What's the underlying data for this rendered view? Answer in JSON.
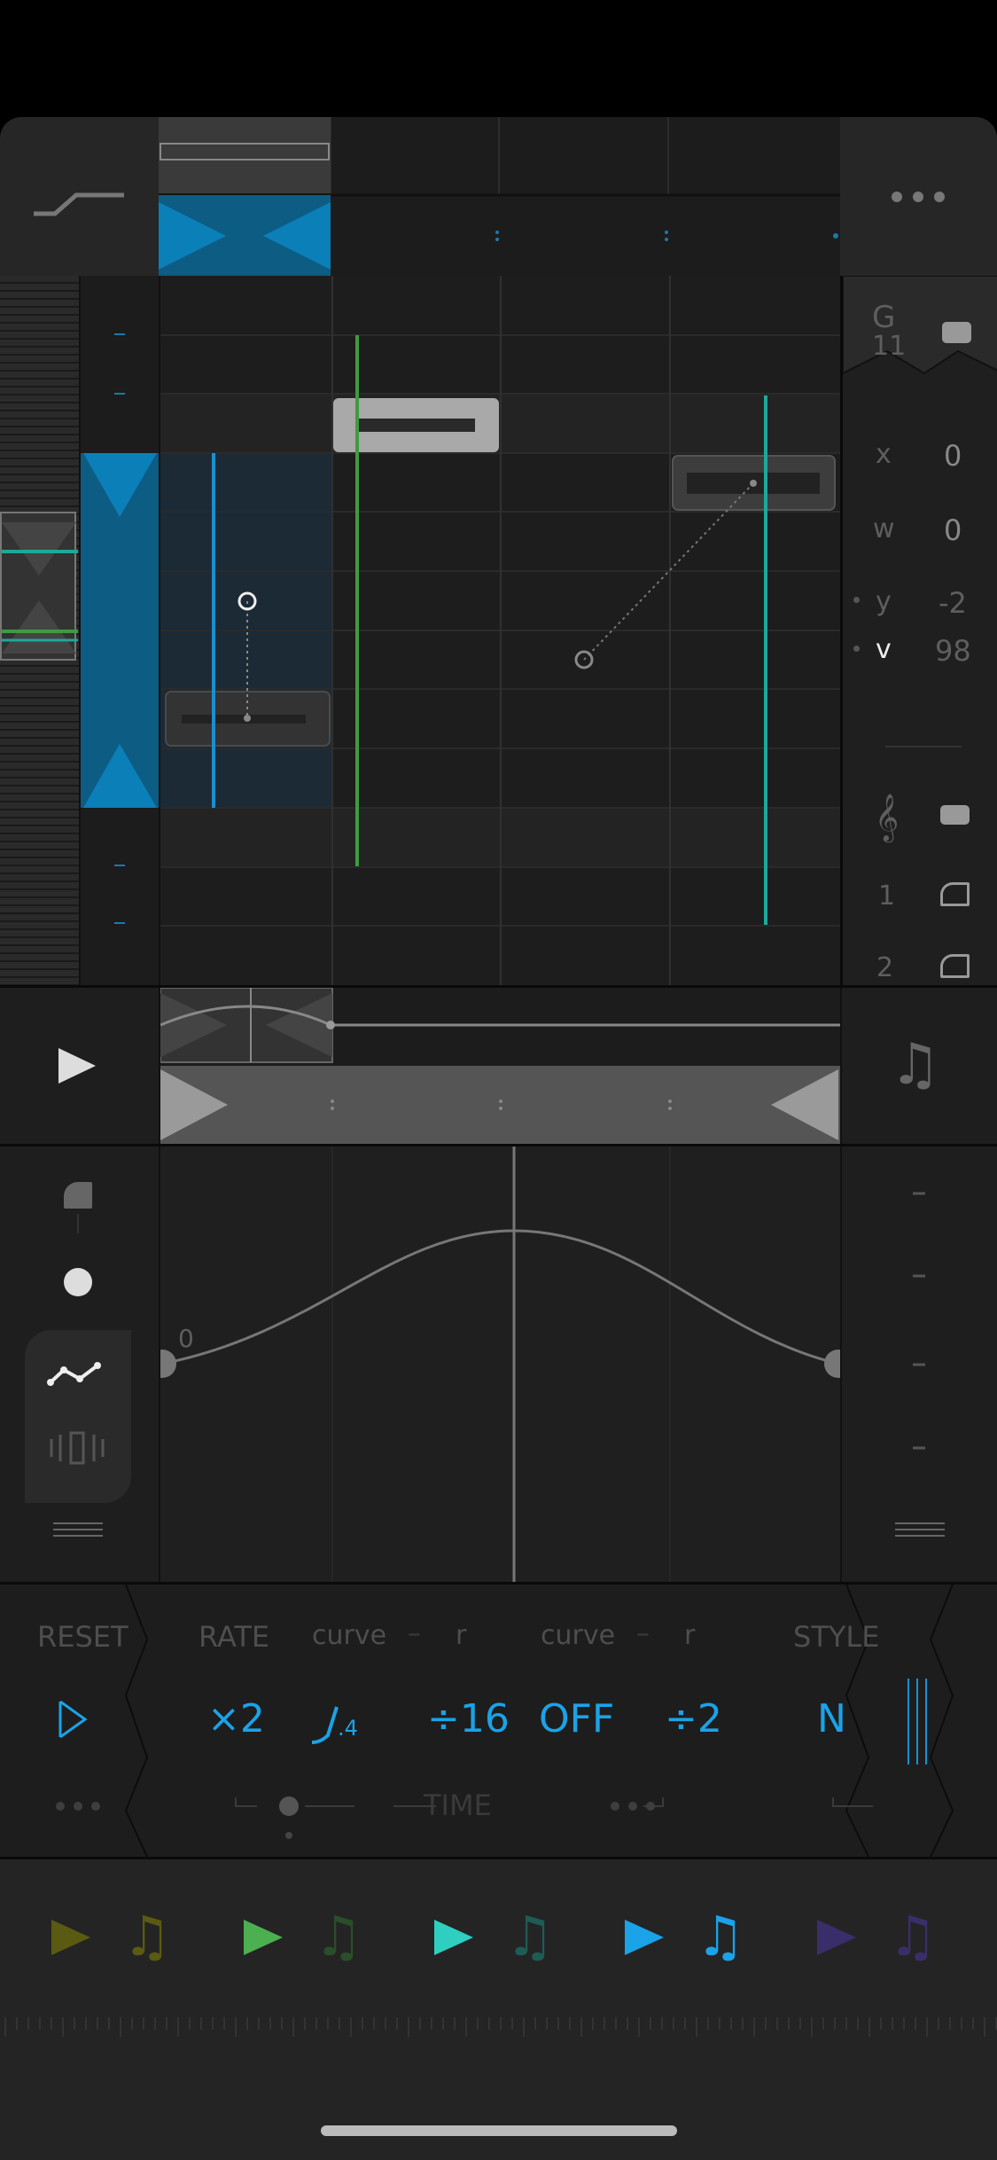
{
  "inspector": {
    "note_name": "G",
    "note_octave": "11",
    "params": [
      {
        "label": "x",
        "value": "0"
      },
      {
        "label": "w",
        "value": "0"
      },
      {
        "label": "y",
        "value": "-2"
      },
      {
        "label": "v",
        "value": "98"
      }
    ],
    "tracks": [
      "1",
      "2"
    ]
  },
  "curve": {
    "start_label": "0"
  },
  "controls": {
    "reset_label": "RESET",
    "rate_label": "RATE",
    "curve1_label": "curve",
    "dash1": "–",
    "r1_label": "r",
    "curve2_label": "curve",
    "dash2": "–",
    "r2_label": "r",
    "style_label": "STYLE",
    "rate_value": "×2",
    "curve1_value": ".4",
    "r1_value": "÷16",
    "curve2_value": "OFF",
    "r2_value": "÷2",
    "style_value": "N",
    "time_label": "TIME"
  },
  "colors": {
    "accent": "#1aa3e8",
    "green": "#3f9b3f",
    "teal": "#1fa89a"
  }
}
